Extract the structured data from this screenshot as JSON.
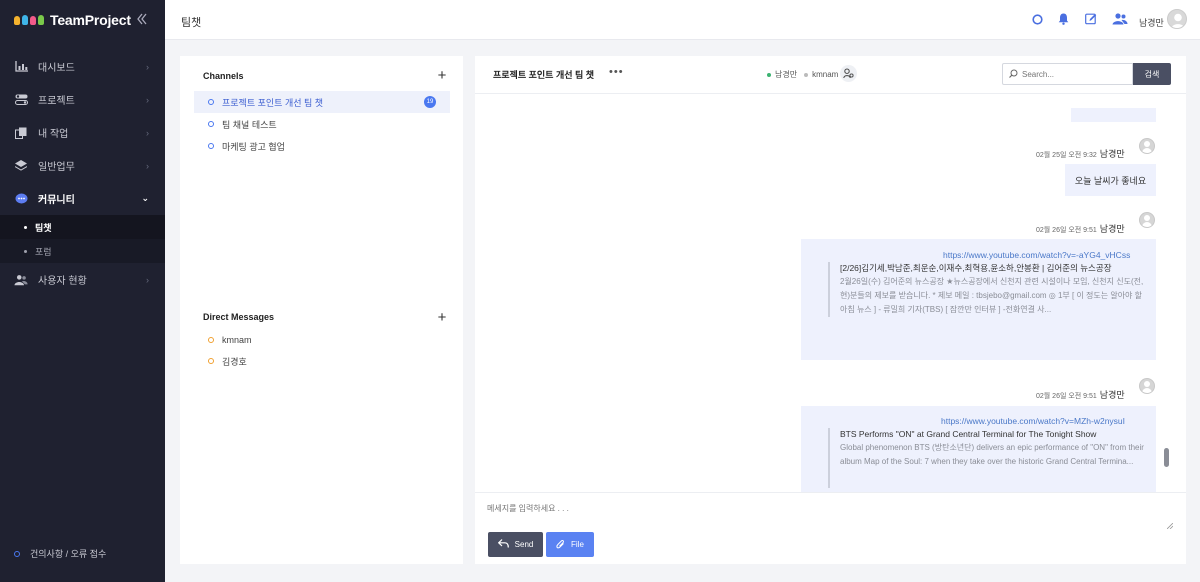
{
  "app": {
    "name": "TeamProject",
    "page_title": "팀챗"
  },
  "colors": {
    "sidebar_bg": "#1f2130",
    "accent": "#4a78f0",
    "dm_status": "#f0a030",
    "bubble_bg": "#eef1fd"
  },
  "sidebar": {
    "items": [
      {
        "label": "대시보드",
        "icon": "chart-icon"
      },
      {
        "label": "프로젝트",
        "icon": "toggle-icon"
      },
      {
        "label": "내 작업",
        "icon": "copy-icon"
      },
      {
        "label": "일반업무",
        "icon": "layers-icon"
      },
      {
        "label": "커뮤니티",
        "icon": "chat-bubble-icon"
      },
      {
        "label": "사용자 현황",
        "icon": "users-icon"
      }
    ],
    "community_sub": [
      {
        "label": "팀챗"
      },
      {
        "label": "포럼"
      }
    ],
    "feedback": "건의사항 / 오류 접수"
  },
  "header": {
    "user_name": "남경만"
  },
  "channels": {
    "title": "Channels",
    "items": [
      {
        "label": "프로젝트 포인트 개선 팀 챗",
        "badge": "19"
      },
      {
        "label": "팀 채널 테스트"
      },
      {
        "label": "마케팅 광고 협업"
      }
    ]
  },
  "direct_messages": {
    "title": "Direct Messages",
    "items": [
      {
        "label": "kmnam"
      },
      {
        "label": "김경호"
      }
    ]
  },
  "chat": {
    "title": "프로젝트 포인트 개선 팀 챗",
    "more": "•••",
    "members": [
      {
        "name": "남경만",
        "online": true
      },
      {
        "name": "kmnam",
        "online": false
      }
    ],
    "search_placeholder": "Search...",
    "search_button": "검색",
    "messages": [
      {
        "time": "02월 25일 오전 9:32",
        "author": "남경만",
        "text": "오늘 날씨가 좋네요"
      },
      {
        "time": "02월 26일 오전 9:51",
        "author": "남경만",
        "link": "https://www.youtube.com/watch?v=-aYG4_vHCss",
        "preview_title": "[2/26]김기세,박남준,최운순,이재수,최혁용,윤소하,안봉환 | 김어준의 뉴스공장",
        "preview_desc": "2월26일(수) 김어준의 뉴스공장 ★뉴스공장에서 신천지 관련 시설이나 모임, 신천지 신도(전,현)분들의 제보를 받습니다. * 제보 메일 : tbsjebo@gmail.com ◎ 1부 [ 이 정도는 알아야 할 아침 뉴스 ] - 류밀희 기자(TBS) [ 잠깐만 인터뷰 ] -전화연결 사..."
      },
      {
        "time": "02월 26일 오전 9:51",
        "author": "남경만",
        "link": "https://www.youtube.com/watch?v=MZh-w2nysuI",
        "preview_title": "BTS Performs \"ON\" at Grand Central Terminal for The Tonight Show",
        "preview_desc": "Global phenomenon BTS (방탄소년단) delivers an epic performance of \"ON\" from their album Map of the Soul: 7 when they take over the historic Grand Central Termina..."
      }
    ],
    "input_placeholder": "메세지를 입력하세요 . . .",
    "send_label": "Send",
    "file_label": "File"
  }
}
